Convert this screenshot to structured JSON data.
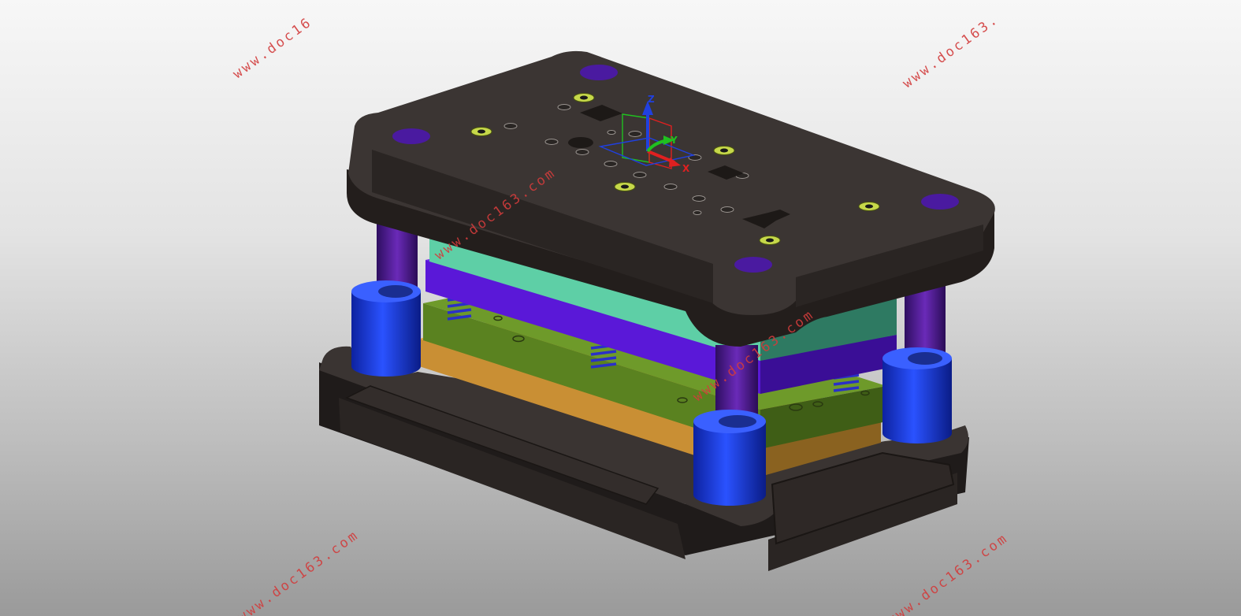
{
  "watermark": {
    "text_full": "www.doc163.com",
    "text_cut_top_left": "www.doc16",
    "text_cut_top_right": "www.doc163.",
    "color": "#d23c3c"
  },
  "triad": {
    "x_label": "X",
    "y_label": "Y",
    "z_label": "Z",
    "x_color": "#e02020",
    "y_color": "#20c020",
    "z_color": "#2040e0"
  },
  "model": {
    "plate_color": "#2f2a28",
    "stripper_color": "#5ecfa6",
    "punch_holder_color": "#5a18d8",
    "die_plate_color": "#5f8a22",
    "backing_plate_color": "#d8a048",
    "bushing_color": "#1838d8",
    "pillar_color": "#4a1a8a",
    "spring_color": "#2a30c8",
    "screw_color": "#c6d84a"
  }
}
